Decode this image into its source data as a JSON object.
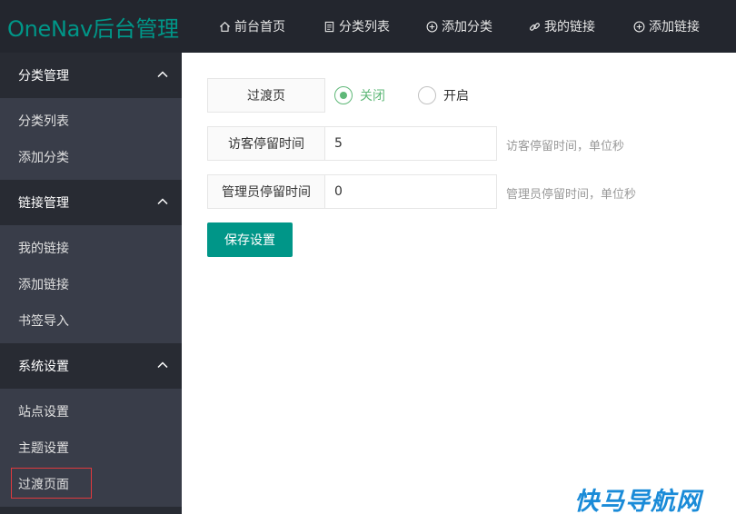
{
  "header": {
    "logo": "OneNav后台管理",
    "nav": [
      {
        "label": "前台首页",
        "icon": "home-icon"
      },
      {
        "label": "分类列表",
        "icon": "document-icon"
      },
      {
        "label": "添加分类",
        "icon": "plus-circle-icon"
      },
      {
        "label": "我的链接",
        "icon": "link-icon"
      },
      {
        "label": "添加链接",
        "icon": "plus-circle-icon"
      }
    ]
  },
  "sidebar": {
    "groups": [
      {
        "label": "分类管理",
        "items": [
          "分类列表",
          "添加分类"
        ]
      },
      {
        "label": "链接管理",
        "items": [
          "我的链接",
          "添加链接",
          "书签导入"
        ]
      },
      {
        "label": "系统设置",
        "items": [
          "站点设置",
          "主题设置",
          "过渡页面"
        ]
      }
    ],
    "active_item": "过渡页面"
  },
  "form": {
    "transition": {
      "label": "过渡页",
      "options": [
        {
          "label": "关闭",
          "checked": true
        },
        {
          "label": "开启",
          "checked": false
        }
      ]
    },
    "visitor_stay": {
      "label": "访客停留时间",
      "value": "5",
      "hint": "访客停留时间，单位秒"
    },
    "admin_stay": {
      "label": "管理员停留时间",
      "value": "0",
      "hint": "管理员停留时间，单位秒"
    },
    "save_label": "保存设置"
  },
  "watermark": "快马导航网",
  "colors": {
    "header_bg": "#23262e",
    "sidebar_bg": "#393d49",
    "group_bg": "#282b33",
    "accent": "#009688",
    "radio_green": "#5fb878",
    "active_outline": "#e0393e",
    "watermark": "#1a8bd8"
  }
}
